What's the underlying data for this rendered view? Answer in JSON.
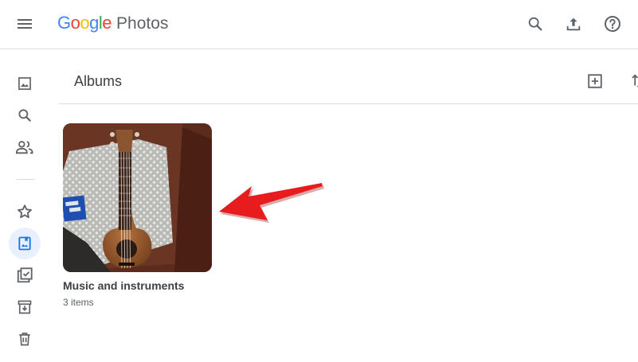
{
  "app": {
    "logo_letters": [
      "G",
      "o",
      "o",
      "g",
      "l",
      "e"
    ],
    "logo_colors": [
      "#4285F4",
      "#EA4335",
      "#FBBC05",
      "#4285F4",
      "#34A853",
      "#EA4335"
    ],
    "product_name": "Photos"
  },
  "header": {
    "icons": [
      "menu-icon",
      "search-icon",
      "upload-icon",
      "help-icon"
    ]
  },
  "sidebar": {
    "items": [
      {
        "icon": "photos-icon"
      },
      {
        "icon": "search-icon"
      },
      {
        "icon": "sharing-icon"
      },
      {
        "icon": "star-icon"
      },
      {
        "icon": "albums-icon",
        "active": true
      },
      {
        "icon": "utilities-icon"
      },
      {
        "icon": "archive-icon"
      },
      {
        "icon": "trash-icon"
      }
    ]
  },
  "main": {
    "title": "Albums",
    "actions": [
      "add-icon",
      "sort-icon"
    ],
    "albums": [
      {
        "name": "Music and instruments",
        "count": "3 items"
      }
    ]
  },
  "colors": {
    "accent": "#1a73e8",
    "active_bg": "#e8f0fe",
    "annotation_arrow": "#e81c1c"
  }
}
